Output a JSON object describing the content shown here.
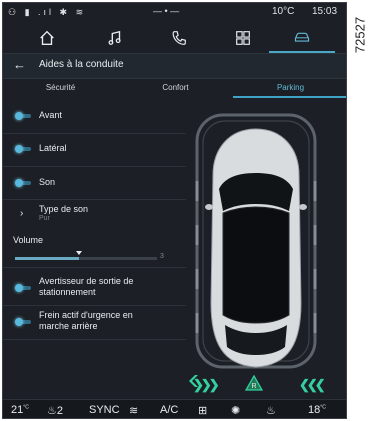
{
  "figure_id": "72527",
  "status": {
    "temperature": "10°C",
    "time": "15:03"
  },
  "nav_tabs": [
    "home-icon",
    "music-icon",
    "phone-icon",
    "apps-icon",
    "car-icon"
  ],
  "header": {
    "back_icon": "arrow-left-icon",
    "title": "Aides à la conduite"
  },
  "subtabs": [
    {
      "label": "Sécurité",
      "active": false
    },
    {
      "label": "Confort",
      "active": false
    },
    {
      "label": "Parking",
      "active": true
    }
  ],
  "settings": {
    "avant": "Avant",
    "lateral": "Latéral",
    "son": "Son",
    "type_de_son": "Type de son",
    "type_de_son_value": "Pur",
    "volume_label": "Volume",
    "volume_value": "3",
    "volume_level_fraction": 0.45,
    "exit_warning": "Avertisseur de sortie de stationnement",
    "emergency_brake": "Frein actif d'urgence en marche arrière"
  },
  "bottom_bar": {
    "temp_left": "21",
    "temp_left_unit": "°C",
    "seat_level": "2",
    "sync": "SYNC",
    "ac": "A/C",
    "temp_right": "18",
    "temp_right_unit": "°C"
  },
  "colors": {
    "accent": "#4aa8c8",
    "toggle_on": "#59b9dc",
    "parking_arrows": "#34d0a0"
  }
}
